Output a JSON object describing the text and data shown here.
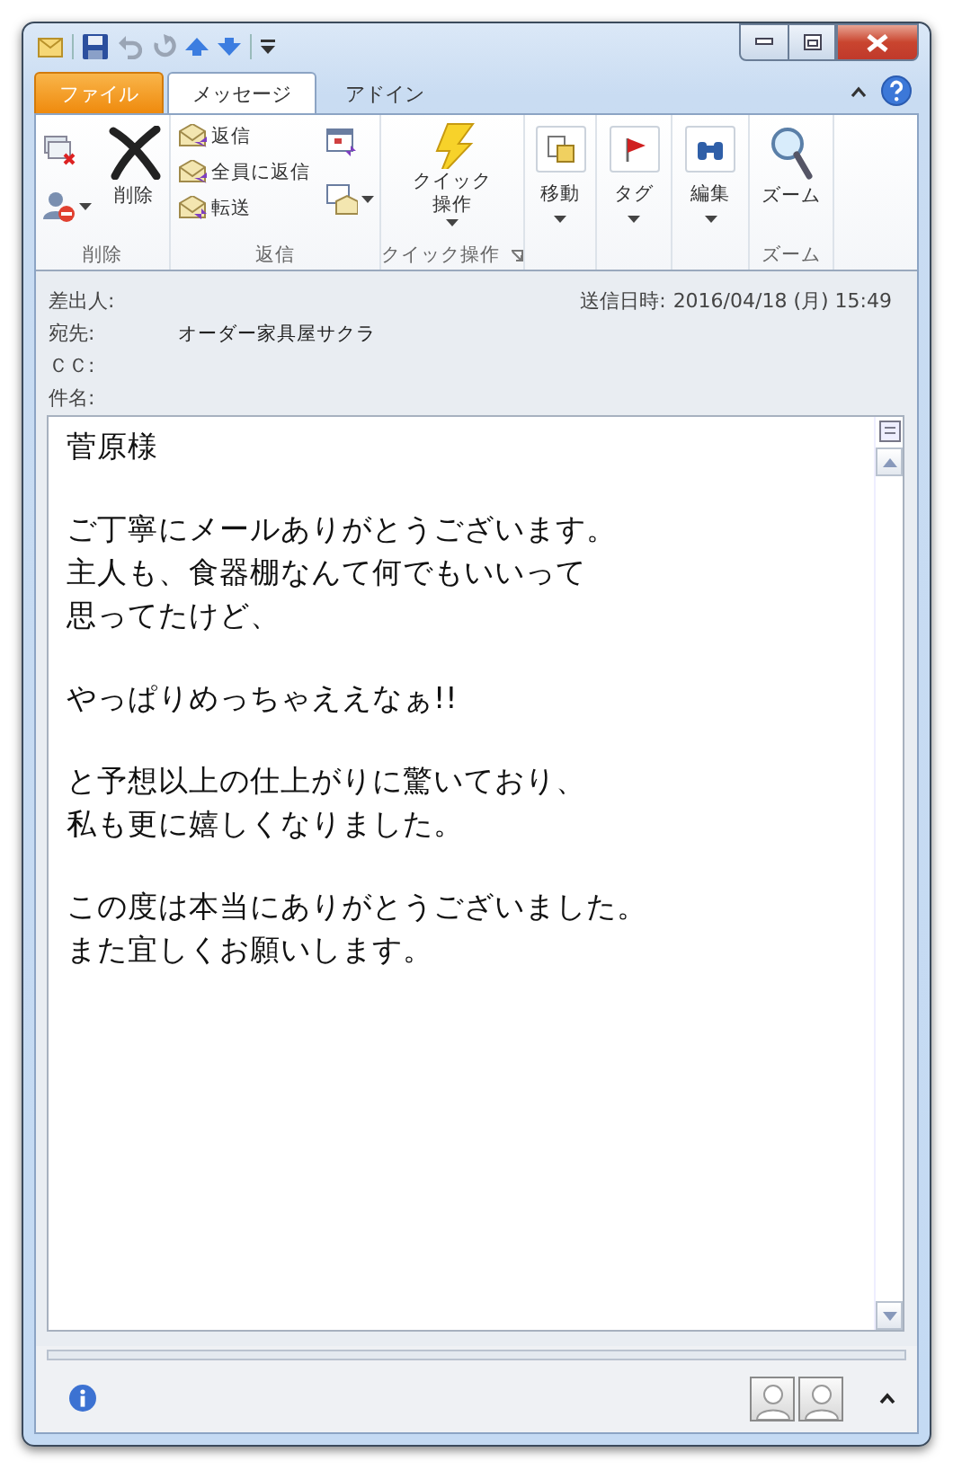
{
  "tabs": [
    {
      "label": "ファイル",
      "kind": "file",
      "selected": false
    },
    {
      "label": "メッセージ",
      "kind": "tab",
      "selected": true
    },
    {
      "label": "アドイン",
      "kind": "tab",
      "selected": false
    }
  ],
  "ribbon": [
    {
      "kind": "delete",
      "label": "削除",
      "buttons": [
        "削除"
      ]
    },
    {
      "kind": "respond",
      "label": "返信",
      "buttons": [
        "返信",
        "全員に返信",
        "転送"
      ]
    },
    {
      "kind": "quick",
      "label": "クイック操作",
      "buttons": [
        "クイック操作"
      ]
    },
    {
      "kind": "move",
      "buttons": [
        "移動"
      ]
    },
    {
      "kind": "tags",
      "buttons": [
        "タグ"
      ]
    },
    {
      "kind": "editing",
      "buttons": [
        "編集"
      ]
    },
    {
      "kind": "zoom",
      "label": "ズーム",
      "buttons": [
        "ズーム"
      ]
    }
  ],
  "header": {
    "fields": [
      {
        "label": "差出人:"
      },
      {
        "label": "宛先:",
        "value": "オーダー家具屋サクラ"
      },
      {
        "label": "ＣＣ:"
      },
      {
        "label": "件名:"
      }
    ],
    "sent": {
      "label": "送信日時:",
      "value": "2016/04/18 (月) 15:49"
    }
  },
  "body": {
    "paragraphs": [
      [
        "菅原様"
      ],
      [
        "ご丁寧にメールありがとうございます。",
        "主人も、食器棚なんて何でもいいって",
        "思ってたけど、"
      ],
      [
        "やっぱりめっちゃええなぁ!!"
      ],
      [
        "と予想以上の仕上がりに驚いており、",
        "私も更に嬉しくなりました。"
      ],
      [
        "この度は本当にありがとうございました。",
        "また宜しくお願いします。"
      ]
    ]
  }
}
